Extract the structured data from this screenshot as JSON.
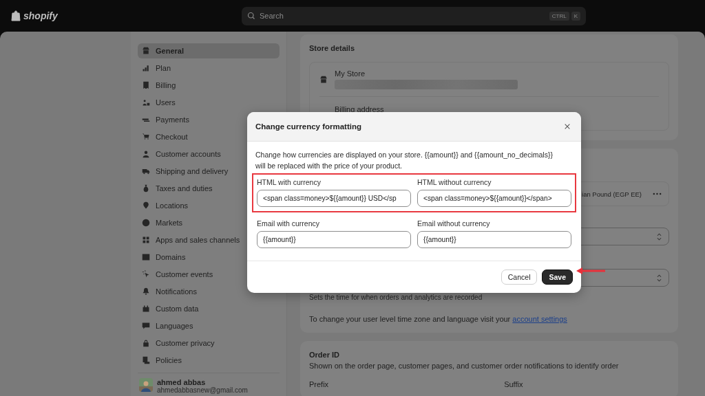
{
  "topbar": {
    "logo": "shopify",
    "search": {
      "placeholder": "Search",
      "shortcut": [
        "CTRL",
        "K"
      ]
    }
  },
  "sidebar": {
    "items": [
      {
        "label": "General",
        "selected": true
      },
      {
        "label": "Plan",
        "selected": false
      },
      {
        "label": "Billing",
        "selected": false
      },
      {
        "label": "Users",
        "selected": false
      },
      {
        "label": "Payments",
        "selected": false
      },
      {
        "label": "Checkout",
        "selected": false
      },
      {
        "label": "Customer accounts",
        "selected": false
      },
      {
        "label": "Shipping and delivery",
        "selected": false
      },
      {
        "label": "Taxes and duties",
        "selected": false
      },
      {
        "label": "Locations",
        "selected": false
      },
      {
        "label": "Markets",
        "selected": false
      },
      {
        "label": "Apps and sales channels",
        "selected": false
      },
      {
        "label": "Domains",
        "selected": false
      },
      {
        "label": "Customer events",
        "selected": false
      },
      {
        "label": "Notifications",
        "selected": false
      },
      {
        "label": "Custom data",
        "selected": false
      },
      {
        "label": "Languages",
        "selected": false
      },
      {
        "label": "Customer privacy",
        "selected": false
      },
      {
        "label": "Policies",
        "selected": false
      }
    ],
    "user": {
      "name": "ahmed abbas",
      "email": "ahmedabbasnew@gmail.com"
    }
  },
  "store_details": {
    "title": "Store details",
    "store_name": "My Store",
    "billing_label": "Billing address"
  },
  "defaults_card": {
    "currency_value": "ian Pound (EGP EE)",
    "timezone_hint": "Sets the time for when orders and analytics are recorded",
    "account_note": "To change your user level time zone and language visit your",
    "account_link": "account settings"
  },
  "order_id": {
    "title": "Order ID",
    "description": "Shown on the order page, customer pages, and customer order notifications to identify order",
    "prefix_label": "Prefix",
    "suffix_label": "Suffix"
  },
  "modal": {
    "title": "Change currency formatting",
    "description": "Change how currencies are displayed on your store. {{amount}} and {{amount_no_decimals}} will be replaced with the price of your product.",
    "field_rows": [
      {
        "highlighted": true,
        "fields": [
          {
            "label": "HTML with currency",
            "value": "<span class=money>${{amount}} USD</sp"
          },
          {
            "label": "HTML without currency",
            "value": "<span class=money>${{amount}}</span>"
          }
        ]
      },
      {
        "highlighted": false,
        "fields": [
          {
            "label": "Email with currency",
            "value": "{{amount}}"
          },
          {
            "label": "Email without currency",
            "value": "{{amount}}"
          }
        ]
      }
    ],
    "buttons": {
      "cancel": "Cancel",
      "save": "Save"
    }
  }
}
